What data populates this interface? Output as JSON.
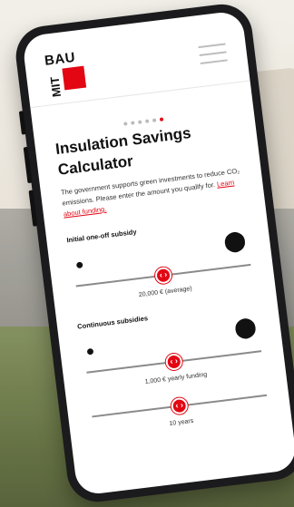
{
  "brand": {
    "logo_text": "BAU",
    "logo_text2": "MIT",
    "accent": "#e30613"
  },
  "carousel": {
    "total": 6,
    "active": 6
  },
  "calculator": {
    "title": "Insulation Savings Calculator",
    "description": "The government supports green investments to reduce CO₂ emissions. Please enter the amount you qualify for.",
    "link_text": "Learn about funding."
  },
  "initial_subsidy": {
    "label": "Initial one-off subsidy",
    "value_text": "20,000 € (average)",
    "level": 0.5,
    "icon_small": "coin-icon",
    "icon_big": "coin-stack-icon"
  },
  "continuous_subsidies": {
    "label": "Continuous subsidies",
    "value_text": "1,000 € yearly funding",
    "level": 0.5,
    "icon_small": "coin-icon",
    "icon_big": "coin-stack-icon"
  },
  "duration": {
    "value_text": "10 years",
    "level": 0.5
  }
}
